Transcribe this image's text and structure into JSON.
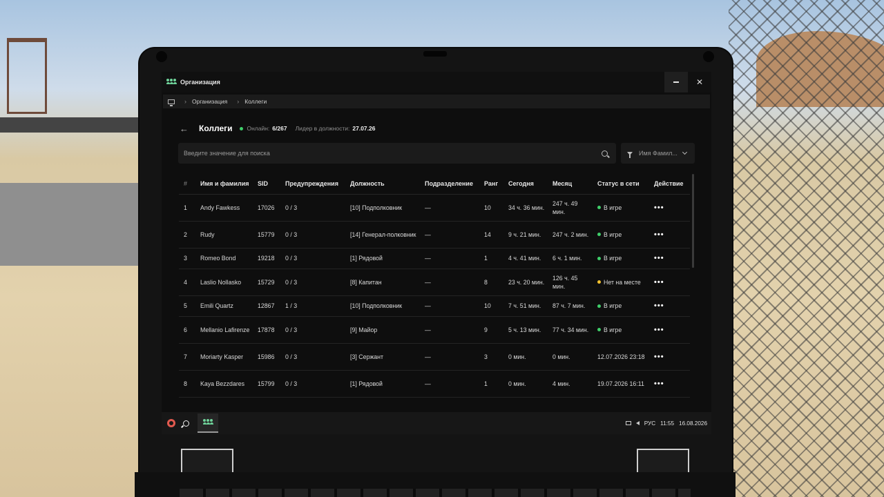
{
  "window": {
    "title": "Организация",
    "close_label": "✕"
  },
  "breadcrumb": {
    "items": [
      "Организация",
      "Коллеги"
    ],
    "separator": "›"
  },
  "header": {
    "back_label": "←",
    "title": "Коллеги",
    "online_label": "Онлайн:",
    "online_value": "6/267",
    "leader_label": "Лидер в должности:",
    "leader_value": "27.07.26"
  },
  "search": {
    "placeholder": "Введите значение для поиска"
  },
  "filter": {
    "label": "Имя Фамил..."
  },
  "table": {
    "columns": [
      "#",
      "Имя и фамилия",
      "SID",
      "Предупреждения",
      "Должность",
      "Подразделение",
      "Ранг",
      "Сегодня",
      "Месяц",
      "Статус в сети",
      "Действие"
    ],
    "rows": [
      {
        "num": "1",
        "name": "Andy Fawkess",
        "sid": "17026",
        "warn": "0 / 3",
        "pos": "[10] Подполковник",
        "dept": "—",
        "rank": "10",
        "today": "34 ч. 36 мин.",
        "month": "247 ч. 49 мин.",
        "status": "В игре",
        "status_color": "#3fcf6a",
        "action": "•••"
      },
      {
        "num": "2",
        "name": "Rudy",
        "sid": "15779",
        "warn": "0 / 3",
        "pos": "[14] Генерал-полковник",
        "dept": "—",
        "rank": "14",
        "today": "9 ч. 21 мин.",
        "month": "247 ч. 2 мин.",
        "status": "В игре",
        "status_color": "#3fcf6a",
        "action": "•••"
      },
      {
        "num": "3",
        "name": "Romeo Bond",
        "sid": "19218",
        "warn": "0 / 3",
        "pos": "[1] Рядовой",
        "dept": "—",
        "rank": "1",
        "today": "4 ч. 41 мин.",
        "month": "6 ч. 1 мин.",
        "status": "В игре",
        "status_color": "#3fcf6a",
        "action": "•••"
      },
      {
        "num": "4",
        "name": "Laslio Nollasko",
        "sid": "15729",
        "warn": "0 / 3",
        "pos": "[8] Капитан",
        "dept": "—",
        "rank": "8",
        "today": "23 ч. 20 мин.",
        "month": "126 ч. 45 мин.",
        "status": "Нет на месте",
        "status_color": "#f2c12e",
        "action": "•••"
      },
      {
        "num": "5",
        "name": "Emili Quartz",
        "sid": "12867",
        "warn": "1 / 3",
        "pos": "[10] Подполковник",
        "dept": "—",
        "rank": "10",
        "today": "7 ч. 51 мин.",
        "month": "87 ч. 7 мин.",
        "status": "В игре",
        "status_color": "#3fcf6a",
        "action": "•••"
      },
      {
        "num": "6",
        "name": "Mellanio Lafirenze",
        "sid": "17878",
        "warn": "0 / 3",
        "pos": "[9] Майор",
        "dept": "—",
        "rank": "9",
        "today": "5 ч. 13 мин.",
        "month": "77 ч. 34 мин.",
        "status": "В игре",
        "status_color": "#3fcf6a",
        "action": "•••"
      },
      {
        "num": "7",
        "name": "Moriarty Kasper",
        "sid": "15986",
        "warn": "0 / 3",
        "pos": "[3] Сержант",
        "dept": "—",
        "rank": "3",
        "today": "0 мин.",
        "month": "0 мин.",
        "status": "12.07.2026 23:18",
        "status_color": "",
        "action": "•••"
      },
      {
        "num": "8",
        "name": "Kaya Bezzdares",
        "sid": "15799",
        "warn": "0 / 3",
        "pos": "[1] Рядовой",
        "dept": "—",
        "rank": "1",
        "today": "0 мин.",
        "month": "4 мин.",
        "status": "19.07.2026 16:11",
        "status_color": "",
        "action": "•••"
      }
    ]
  },
  "taskbar": {
    "language": "РУС",
    "time": "11:55",
    "date": "16.08.2026"
  },
  "icons": {
    "app": "people-icon",
    "breadcrumb_root": "monitor-icon",
    "search": "search-icon",
    "filter": "filter-icon",
    "logo": "majestic-logo-icon",
    "tray_display": "monitor-icon",
    "tray_volume": "speaker-icon"
  },
  "colors": {
    "accent_online": "#3fcf6a",
    "accent_away": "#f2c12e",
    "app_icon": "#6fd39a"
  }
}
